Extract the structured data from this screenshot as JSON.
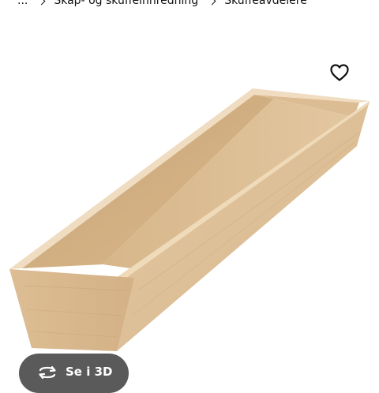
{
  "breadcrumb": {
    "items": [
      {
        "label": "..."
      },
      {
        "label": "Skap- og skuffeinnredning"
      },
      {
        "label": "Skuffeavdelere"
      }
    ]
  },
  "product": {
    "favorite_icon": "heart-outline-icon",
    "view_3d_label": "Se i 3D",
    "view_3d_icon": "rotate-360-icon"
  }
}
